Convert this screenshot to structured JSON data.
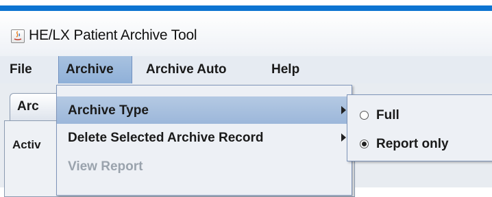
{
  "window": {
    "title": "HE/LX Patient Archive Tool"
  },
  "menubar": {
    "items": [
      "File",
      "Archive",
      "Archive Auto",
      "Help"
    ]
  },
  "tab": {
    "label_partial": "Arc"
  },
  "panel": {
    "label_partial": "Activ"
  },
  "archive_menu": {
    "items": [
      {
        "label": "Archive Type",
        "has_submenu": true,
        "enabled": true,
        "highlighted": true
      },
      {
        "label": "Delete Selected Archive Record",
        "has_submenu": true,
        "enabled": true,
        "highlighted": false
      },
      {
        "label": "View Report",
        "has_submenu": false,
        "enabled": false,
        "highlighted": false
      }
    ]
  },
  "archive_type_submenu": {
    "options": [
      {
        "label": "Full",
        "selected": false
      },
      {
        "label": "Report only",
        "selected": true
      }
    ]
  },
  "colors": {
    "title_bar_accent": "#0d74d1",
    "menu_highlight": "#9cb7da"
  }
}
